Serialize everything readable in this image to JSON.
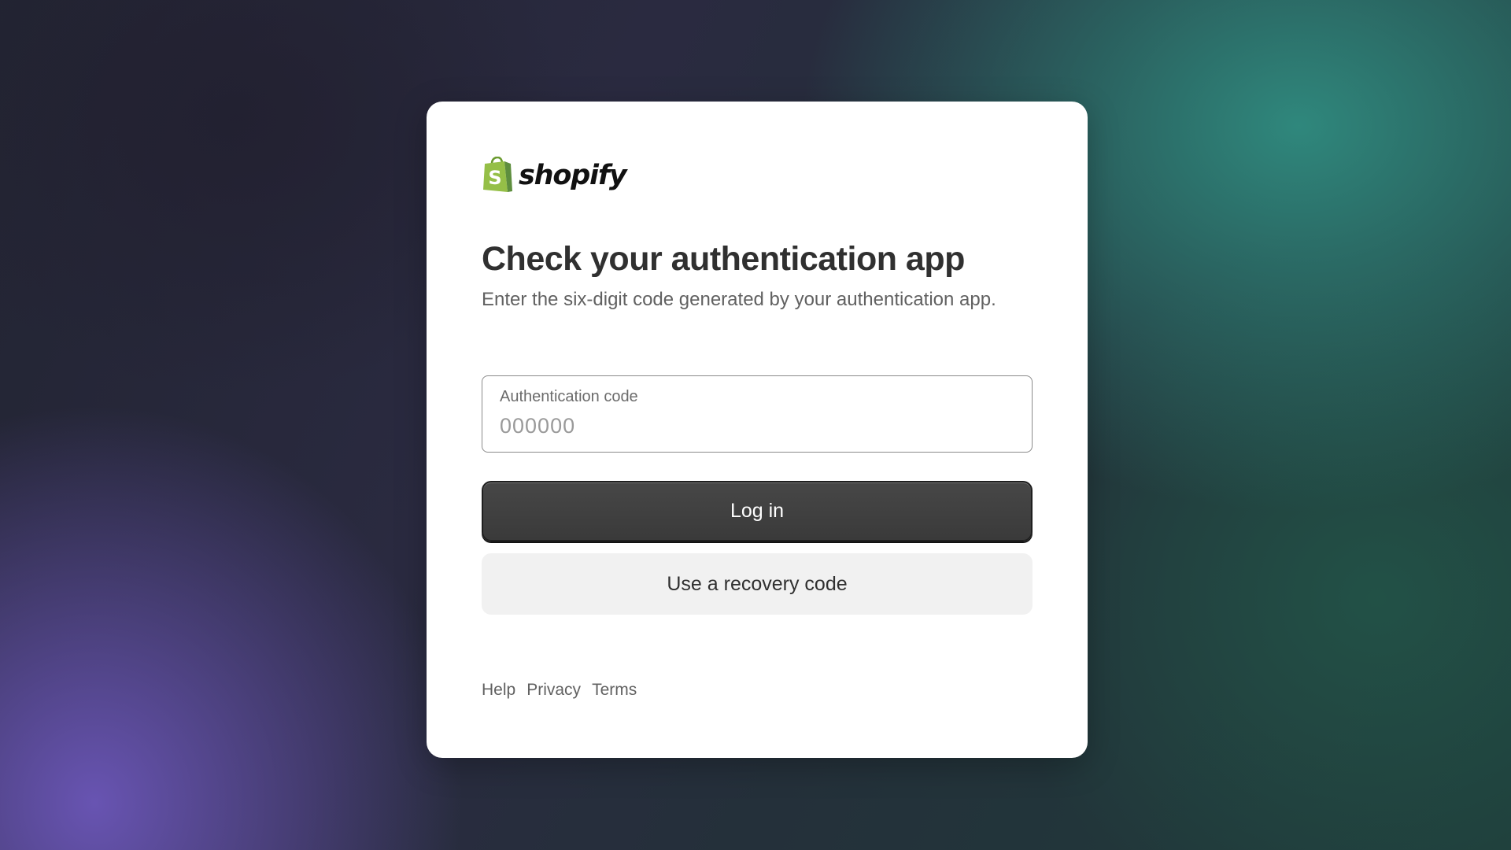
{
  "brand": {
    "name": "shopify",
    "logo_icon": "shopping-bag-icon",
    "logo_color": "#95BF47"
  },
  "auth": {
    "title": "Check your authentication app",
    "subtitle": "Enter the six-digit code generated by your authentication app.",
    "field": {
      "label": "Authentication code",
      "value": "",
      "placeholder": "000000"
    },
    "login_label": "Log in",
    "recovery_label": "Use a recovery code"
  },
  "footer": {
    "links": [
      {
        "label": "Help"
      },
      {
        "label": "Privacy"
      },
      {
        "label": "Terms"
      }
    ]
  }
}
